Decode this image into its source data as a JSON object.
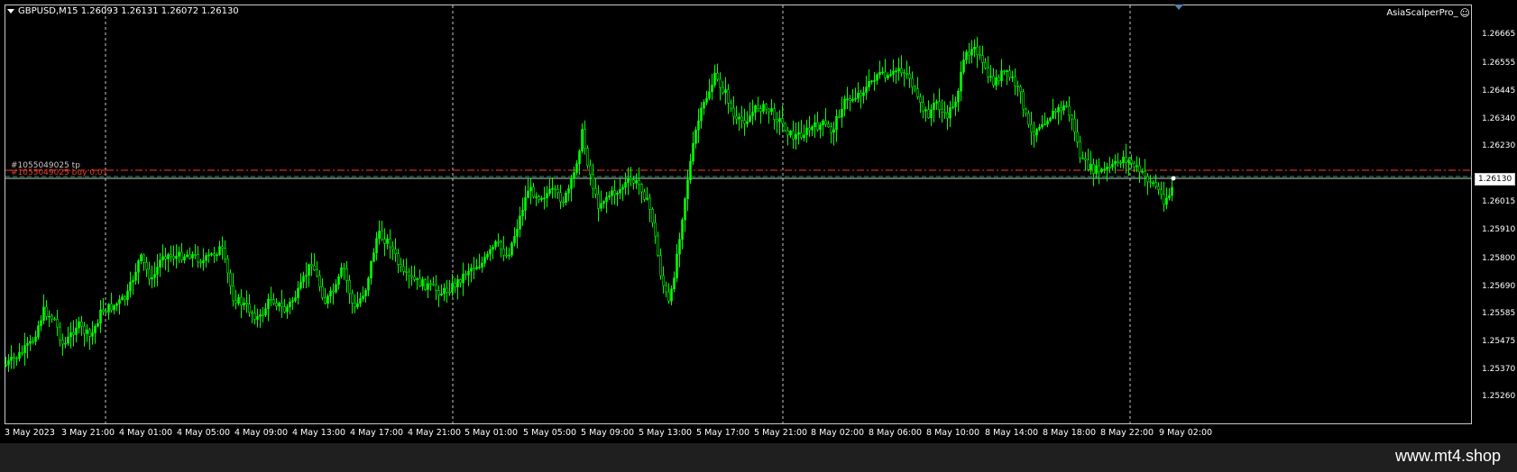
{
  "chart": {
    "symbol_text": "GBPUSD,M15  1.26093 1.26131 1.26072 1.26130",
    "ea_name": "AsiaScalperPro_",
    "ea_icon": "smile-icon",
    "bid_price": "1.26130",
    "order_tp_label": "#1055049025 tp",
    "order_buy_label": "#1055049025 buy 0.01",
    "colors": {
      "candle": "#00ff00",
      "background": "#000000",
      "tp_line": "#ff3b1f",
      "order_line": "#1f9f5f",
      "bid_line": "#c8c8c8",
      "grid": "#c8c8c8"
    },
    "price_ticks": [
      "1.26665",
      "1.26555",
      "1.26445",
      "1.26340",
      "1.26230",
      "1.26130",
      "1.26015",
      "1.25910",
      "1.25800",
      "1.25690",
      "1.25585",
      "1.25475",
      "1.25370",
      "1.25260"
    ],
    "time_ticks": [
      "3 May 2023",
      "3 May 21:00",
      "4 May 01:00",
      "4 May 05:00",
      "4 May 09:00",
      "4 May 13:00",
      "4 May 17:00",
      "4 May 21:00",
      "5 May 01:00",
      "5 May 05:00",
      "5 May 09:00",
      "5 May 13:00",
      "5 May 17:00",
      "5 May 21:00",
      "8 May 02:00",
      "8 May 06:00",
      "8 May 10:00",
      "8 May 14:00",
      "8 May 18:00",
      "8 May 22:00",
      "9 May 02:00"
    ]
  },
  "footer": {
    "brand": "www.mt4.shop"
  }
}
